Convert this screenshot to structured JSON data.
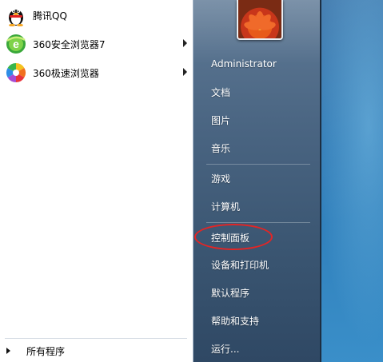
{
  "programs": [
    {
      "label": "腾讯QQ",
      "icon": "qq-penguin-icon",
      "has_submenu": false
    },
    {
      "label": "360安全浏览器7",
      "icon": "360-safe-browser-icon",
      "has_submenu": true
    },
    {
      "label": "360极速浏览器",
      "icon": "360-speed-browser-icon",
      "has_submenu": true
    }
  ],
  "all_programs_label": "所有程序",
  "right_pane": {
    "user_name": "Administrator",
    "items": [
      {
        "label": "文档"
      },
      {
        "label": "图片"
      },
      {
        "label": "音乐"
      },
      {
        "label": "游戏"
      },
      {
        "label": "计算机"
      },
      {
        "label": "控制面板"
      },
      {
        "label": "设备和打印机"
      },
      {
        "label": "默认程序"
      },
      {
        "label": "帮助和支持"
      },
      {
        "label": "运行..."
      }
    ]
  },
  "annotation": {
    "highlighted_item": "控制面板",
    "color": "#e32525"
  },
  "colors": {
    "left_pane": "#ffffff",
    "right_pane": "#4a6582"
  }
}
